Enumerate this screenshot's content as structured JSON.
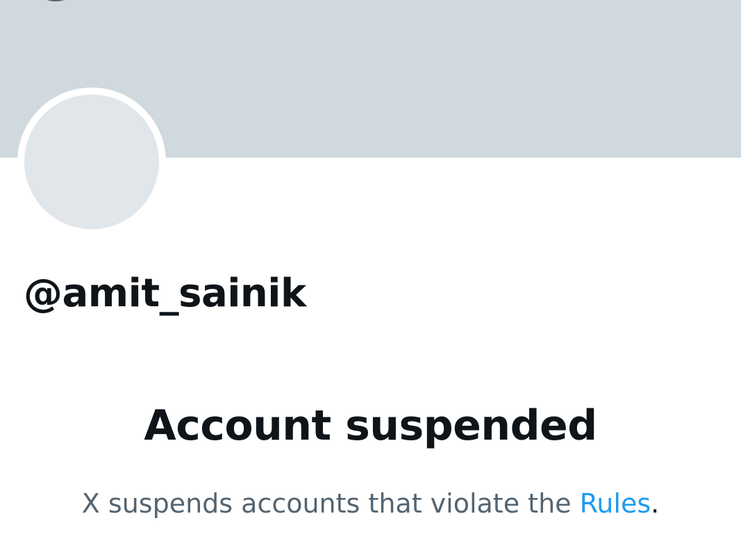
{
  "profile": {
    "handle": "@amit_sainik"
  },
  "suspension": {
    "title": "Account suspended",
    "message_prefix": "X suspends accounts that violate the ",
    "rules_link": "Rules",
    "message_suffix": "."
  },
  "colors": {
    "banner": "#cfd9de",
    "avatar_placeholder": "#e1e6ea",
    "primary_text": "#0f1419",
    "secondary_text": "#536471",
    "link": "#1d9bf0"
  },
  "icons": {
    "back": "back-arrow-icon"
  }
}
